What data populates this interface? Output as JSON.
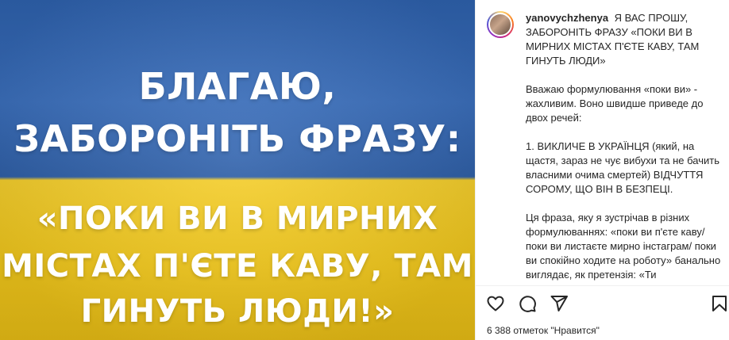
{
  "image": {
    "line1": "БЛАГАЮ,",
    "line2": "ЗАБОРОНІТЬ ФРАЗУ:",
    "line3": "«ПОКИ ВИ В МИРНИХ",
    "line4": "МІСТАХ П'ЄТЕ КАВУ, ТАМ",
    "line5": "ГИНУТЬ ЛЮДИ!»",
    "colors": {
      "blue": "#2f63b0",
      "yellow": "#f3c91c"
    }
  },
  "post": {
    "username": "yanovychzhenya",
    "caption_title": "Я ВАС ПРОШУ, ЗАБОРОНІТЬ ФРАЗУ «ПОКИ ВИ В МИРНИХ МІСТАХ П'ЄТЕ КАВУ, ТАМ ГИНУТЬ ЛЮДИ»",
    "para1": "Вважаю формулювання «поки ви» - жахливим. Воно швидше приведе до двох речей:",
    "para2": "1. ВИКЛИЧЕ В УКРАЇНЦЯ (який, на щастя, зараз не чує вибухи та не бачить власними очима смертей) ВІДЧУТТЯ СОРОМУ, ЩО ВІН В БЕЗПЕЦІ.",
    "para3": "Ця фраза, яку я зустрічав в різних формулюваннях: «поки ви п'єте каву/ поки ви листаєте мирно інстаграм/ поки ви спокійно ходите на роботу» банально виглядає, як претензія: «Ти"
  },
  "actions": {
    "like_icon": "heart-icon",
    "comment_icon": "comment-icon",
    "share_icon": "paper-plane-icon",
    "save_icon": "bookmark-icon"
  },
  "likes_text": "6 388 отметок \"Нравится\""
}
